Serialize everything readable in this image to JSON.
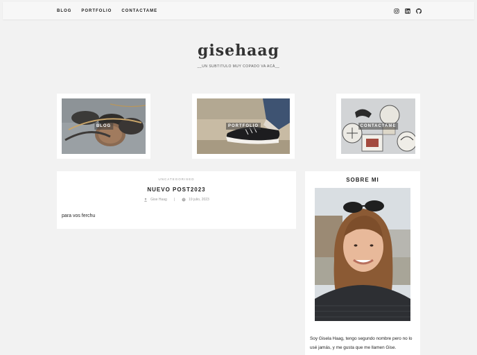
{
  "nav": {
    "items": [
      "BLOG",
      "PORTFOLIO",
      "CONTACTAME"
    ]
  },
  "social": [
    "instagram-icon",
    "linkedin-icon",
    "github-icon"
  ],
  "site": {
    "title": "gisehaag",
    "subtitle": "__UN SUBTITULO MUY COPADO VA ACÁ__"
  },
  "promos": [
    {
      "label": "BLOG"
    },
    {
      "label": "PORTFOLIO"
    },
    {
      "label": "CONTACTAME"
    }
  ],
  "post": {
    "category": "UNCATEGORISED",
    "title": "NUEVO POST2023",
    "author": "Gise Haag",
    "date": "19 julio, 2023",
    "body": "para vos ferchu"
  },
  "sidebar": {
    "title": "SOBRE MI",
    "bio": "Soy Gisela Haag, tengo segundo nombre pero no lo usé jamás, y me gusta que me llamen Gise."
  }
}
